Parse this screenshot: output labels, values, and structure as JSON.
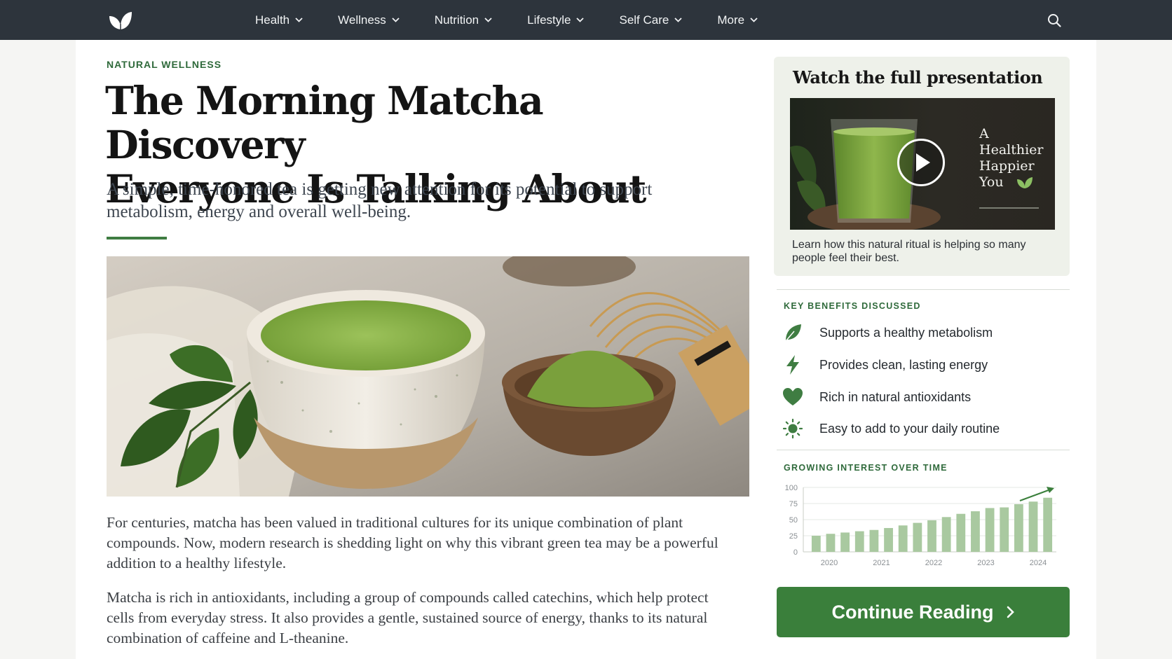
{
  "nav": {
    "items": [
      {
        "label": "Health"
      },
      {
        "label": "Wellness"
      },
      {
        "label": "Nutrition"
      },
      {
        "label": "Lifestyle"
      },
      {
        "label": "Self Care"
      },
      {
        "label": "More"
      }
    ]
  },
  "article": {
    "kicker": "NATURAL WELLNESS",
    "headline_line1": "The Morning Matcha Discovery",
    "headline_line2": "Everyone Is Talking About",
    "dek": "A simple, time-honored tea is getting new attention for its potential to support metabolism, energy and overall well-being.",
    "paragraphs": [
      "For centuries, matcha has been valued in traditional cultures for its unique combination of plant compounds. Now, modern research is shedding light on why this vibrant green tea may be a powerful addition to a healthy lifestyle.",
      "Matcha is rich in antioxidants, including a group of compounds called catechins, which help protect cells from everyday stress. It also provides a gentle, sustained source of energy, thanks to its natural combination of caffeine and L-theanine."
    ]
  },
  "sidebar": {
    "video": {
      "title": "Watch the full presentation",
      "overlay_line1": "A",
      "overlay_line2": "Healthier",
      "overlay_line3": "Happier",
      "overlay_line4": "You",
      "caption": "Learn how this natural ritual is helping so many people feel their best."
    },
    "benefits": {
      "heading": "KEY BENEFITS DISCUSSED",
      "items": [
        {
          "label": "Supports a healthy metabolism",
          "icon": "leaf-icon"
        },
        {
          "label": "Provides clean, lasting energy",
          "icon": "lightning-icon"
        },
        {
          "label": "Rich in natural antioxidants",
          "icon": "heart-icon"
        },
        {
          "label": "Easy to add to your daily routine",
          "icon": "sun-icon"
        }
      ]
    },
    "chart_heading": "GROWING INTEREST OVER TIME",
    "cta_label": "Continue Reading"
  },
  "colors": {
    "nav_bg": "#2d343c",
    "accent_green": "#3a7f3b",
    "label_green": "#2f6a3b",
    "bar_green": "#a9c9a0"
  },
  "chart_data": {
    "type": "bar",
    "title": "GROWING INTEREST OVER TIME",
    "xlabel": "",
    "ylabel": "",
    "ylim": [
      0,
      100
    ],
    "yticks": [
      0,
      25,
      50,
      75,
      100
    ],
    "xtick_labels": [
      "2020",
      "2021",
      "2022",
      "2023",
      "2024"
    ],
    "values": [
      25,
      28,
      30,
      32,
      34,
      37,
      41,
      45,
      49,
      54,
      59,
      63,
      68,
      69,
      74,
      78,
      84
    ],
    "grid": true,
    "trend_arrow": true
  }
}
